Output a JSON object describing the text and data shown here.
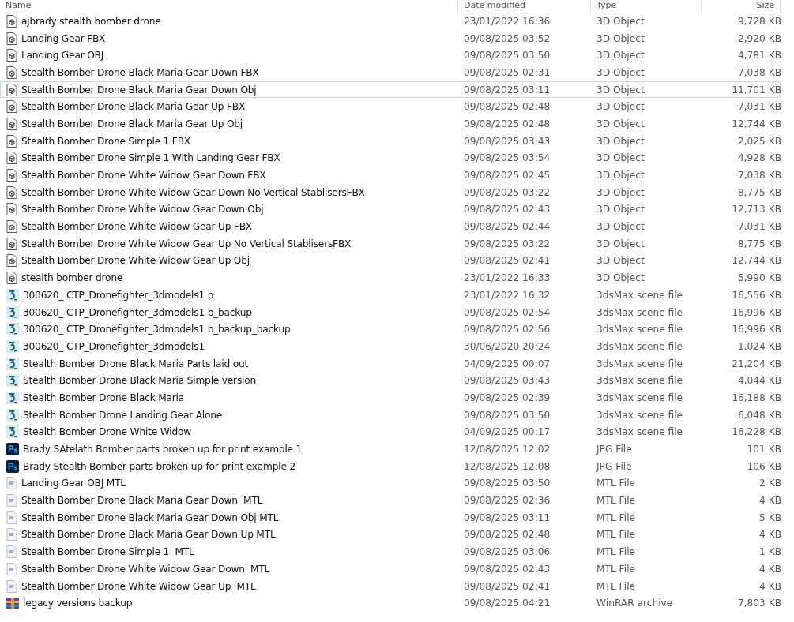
{
  "columns": [
    "Name",
    "Date modified",
    "Type",
    "Size"
  ],
  "files": [
    {
      "kind": "model",
      "name": "ajbrady stealth bomber drone",
      "date": "23/01/2022 16:36",
      "type": "3D Object",
      "size": "9,728 KB",
      "focused": false
    },
    {
      "kind": "model",
      "name": "Landing Gear FBX",
      "date": "09/08/2025 03:52",
      "type": "3D Object",
      "size": "2,920 KB",
      "focused": false
    },
    {
      "kind": "model",
      "name": "Landing Gear OBJ",
      "date": "09/08/2025 03:50",
      "type": "3D Object",
      "size": "4,781 KB",
      "focused": false
    },
    {
      "kind": "model",
      "name": "Stealth Bomber Drone Black Maria Gear Down FBX",
      "date": "09/08/2025 02:31",
      "type": "3D Object",
      "size": "7,038 KB",
      "focused": false
    },
    {
      "kind": "model",
      "name": "Stealth Bomber Drone Black Maria Gear Down Obj",
      "date": "09/08/2025 03:11",
      "type": "3D Object",
      "size": "11,701 KB",
      "focused": true
    },
    {
      "kind": "model",
      "name": "Stealth Bomber Drone Black Maria Gear Up FBX",
      "date": "09/08/2025 02:48",
      "type": "3D Object",
      "size": "7,031 KB",
      "focused": false
    },
    {
      "kind": "model",
      "name": "Stealth Bomber Drone Black Maria Gear Up Obj",
      "date": "09/08/2025 02:48",
      "type": "3D Object",
      "size": "12,744 KB",
      "focused": false
    },
    {
      "kind": "model",
      "name": "Stealth Bomber Drone Simple 1 FBX",
      "date": "09/08/2025 03:43",
      "type": "3D Object",
      "size": "2,025 KB",
      "focused": false
    },
    {
      "kind": "model",
      "name": "Stealth Bomber Drone Simple 1 With Landing Gear FBX",
      "date": "09/08/2025 03:54",
      "type": "3D Object",
      "size": "4,928 KB",
      "focused": false
    },
    {
      "kind": "model",
      "name": "Stealth Bomber Drone White Widow Gear Down FBX",
      "date": "09/08/2025 02:45",
      "type": "3D Object",
      "size": "7,038 KB",
      "focused": false
    },
    {
      "kind": "model",
      "name": "Stealth Bomber Drone White Widow Gear Down No Vertical StablisersFBX",
      "date": "09/08/2025 03:22",
      "type": "3D Object",
      "size": "8,775 KB",
      "focused": false
    },
    {
      "kind": "model",
      "name": "Stealth Bomber Drone White Widow Gear Down Obj",
      "date": "09/08/2025 02:43",
      "type": "3D Object",
      "size": "12,713 KB",
      "focused": false
    },
    {
      "kind": "model",
      "name": "Stealth Bomber Drone White Widow Gear Up FBX",
      "date": "09/08/2025 02:44",
      "type": "3D Object",
      "size": "7,031 KB",
      "focused": false
    },
    {
      "kind": "model",
      "name": "Stealth Bomber Drone White Widow Gear Up No Vertical StablisersFBX",
      "date": "09/08/2025 03:22",
      "type": "3D Object",
      "size": "8,775 KB",
      "focused": false
    },
    {
      "kind": "model",
      "name": "Stealth Bomber Drone White Widow Gear Up Obj",
      "date": "09/08/2025 02:41",
      "type": "3D Object",
      "size": "12,744 KB",
      "focused": false
    },
    {
      "kind": "model",
      "name": "stealth bomber drone",
      "date": "23/01/2022 16:33",
      "type": "3D Object",
      "size": "5,990 KB",
      "focused": false
    },
    {
      "kind": "max",
      "name": "300620_ CTP_Dronefighter_3dmodels1 b",
      "date": "23/01/2022 16:32",
      "type": "3dsMax scene file",
      "size": "16,556 KB",
      "focused": false
    },
    {
      "kind": "max",
      "name": "300620_ CTP_Dronefighter_3dmodels1 b_backup",
      "date": "09/08/2025 02:54",
      "type": "3dsMax scene file",
      "size": "16,996 KB",
      "focused": false
    },
    {
      "kind": "max",
      "name": "300620_ CTP_Dronefighter_3dmodels1 b_backup_backup",
      "date": "09/08/2025 02:56",
      "type": "3dsMax scene file",
      "size": "16,996 KB",
      "focused": false
    },
    {
      "kind": "max",
      "name": "300620_ CTP_Dronefighter_3dmodels1",
      "date": "30/06/2020 20:24",
      "type": "3dsMax scene file",
      "size": "1,024 KB",
      "focused": false
    },
    {
      "kind": "max",
      "name": "Stealth Bomber Drone Black Maria Parts laid out",
      "date": "04/09/2025 00:07",
      "type": "3dsMax scene file",
      "size": "21,204 KB",
      "focused": false
    },
    {
      "kind": "max",
      "name": "Stealth Bomber Drone Black Maria Simple version",
      "date": "09/08/2025 03:43",
      "type": "3dsMax scene file",
      "size": "4,044 KB",
      "focused": false
    },
    {
      "kind": "max",
      "name": "Stealth Bomber Drone Black Maria",
      "date": "09/08/2025 02:39",
      "type": "3dsMax scene file",
      "size": "16,188 KB",
      "focused": false
    },
    {
      "kind": "max",
      "name": "Stealth Bomber Drone Landing Gear Alone",
      "date": "09/08/2025 03:50",
      "type": "3dsMax scene file",
      "size": "6,048 KB",
      "focused": false
    },
    {
      "kind": "max",
      "name": "Stealth Bomber Drone White Widow",
      "date": "04/09/2025 00:17",
      "type": "3dsMax scene file",
      "size": "16,228 KB",
      "focused": false
    },
    {
      "kind": "ps",
      "name": "Brady SAtelath Bomber parts broken up for print example 1",
      "date": "12/08/2025 12:02",
      "type": "JPG File",
      "size": "101 KB",
      "focused": false
    },
    {
      "kind": "ps",
      "name": "Brady Stealth Bomber parts broken up for print example 2",
      "date": "12/08/2025 12:08",
      "type": "JPG File",
      "size": "106 KB",
      "focused": false
    },
    {
      "kind": "mtl",
      "name": "Landing Gear OBJ MTL",
      "date": "09/08/2025 03:50",
      "type": "MTL File",
      "size": "2 KB",
      "focused": false
    },
    {
      "kind": "mtl",
      "name": "Stealth Bomber Drone Black Maria Gear Down  MTL",
      "date": "09/08/2025 02:36",
      "type": "MTL File",
      "size": "4 KB",
      "focused": false
    },
    {
      "kind": "mtl",
      "name": "Stealth Bomber Drone Black Maria Gear Down Obj MTL",
      "date": "09/08/2025 03:11",
      "type": "MTL File",
      "size": "5 KB",
      "focused": false
    },
    {
      "kind": "mtl",
      "name": "Stealth Bomber Drone Black Maria Gear Down Up MTL",
      "date": "09/08/2025 02:48",
      "type": "MTL File",
      "size": "4 KB",
      "focused": false
    },
    {
      "kind": "mtl",
      "name": "Stealth Bomber Drone Simple 1  MTL",
      "date": "09/08/2025 03:06",
      "type": "MTL File",
      "size": "1 KB",
      "focused": false
    },
    {
      "kind": "mtl",
      "name": "Stealth Bomber Drone White Widow Gear Down  MTL",
      "date": "09/08/2025 02:43",
      "type": "MTL File",
      "size": "4 KB",
      "focused": false
    },
    {
      "kind": "mtl",
      "name": "Stealth Bomber Drone White Widow Gear Up  MTL",
      "date": "09/08/2025 02:41",
      "type": "MTL File",
      "size": "4 KB",
      "focused": false
    },
    {
      "kind": "rar",
      "name": "legacy versions backup",
      "date": "09/08/2025 04:21",
      "type": "WinRAR archive",
      "size": "7,803 KB",
      "focused": false
    }
  ]
}
